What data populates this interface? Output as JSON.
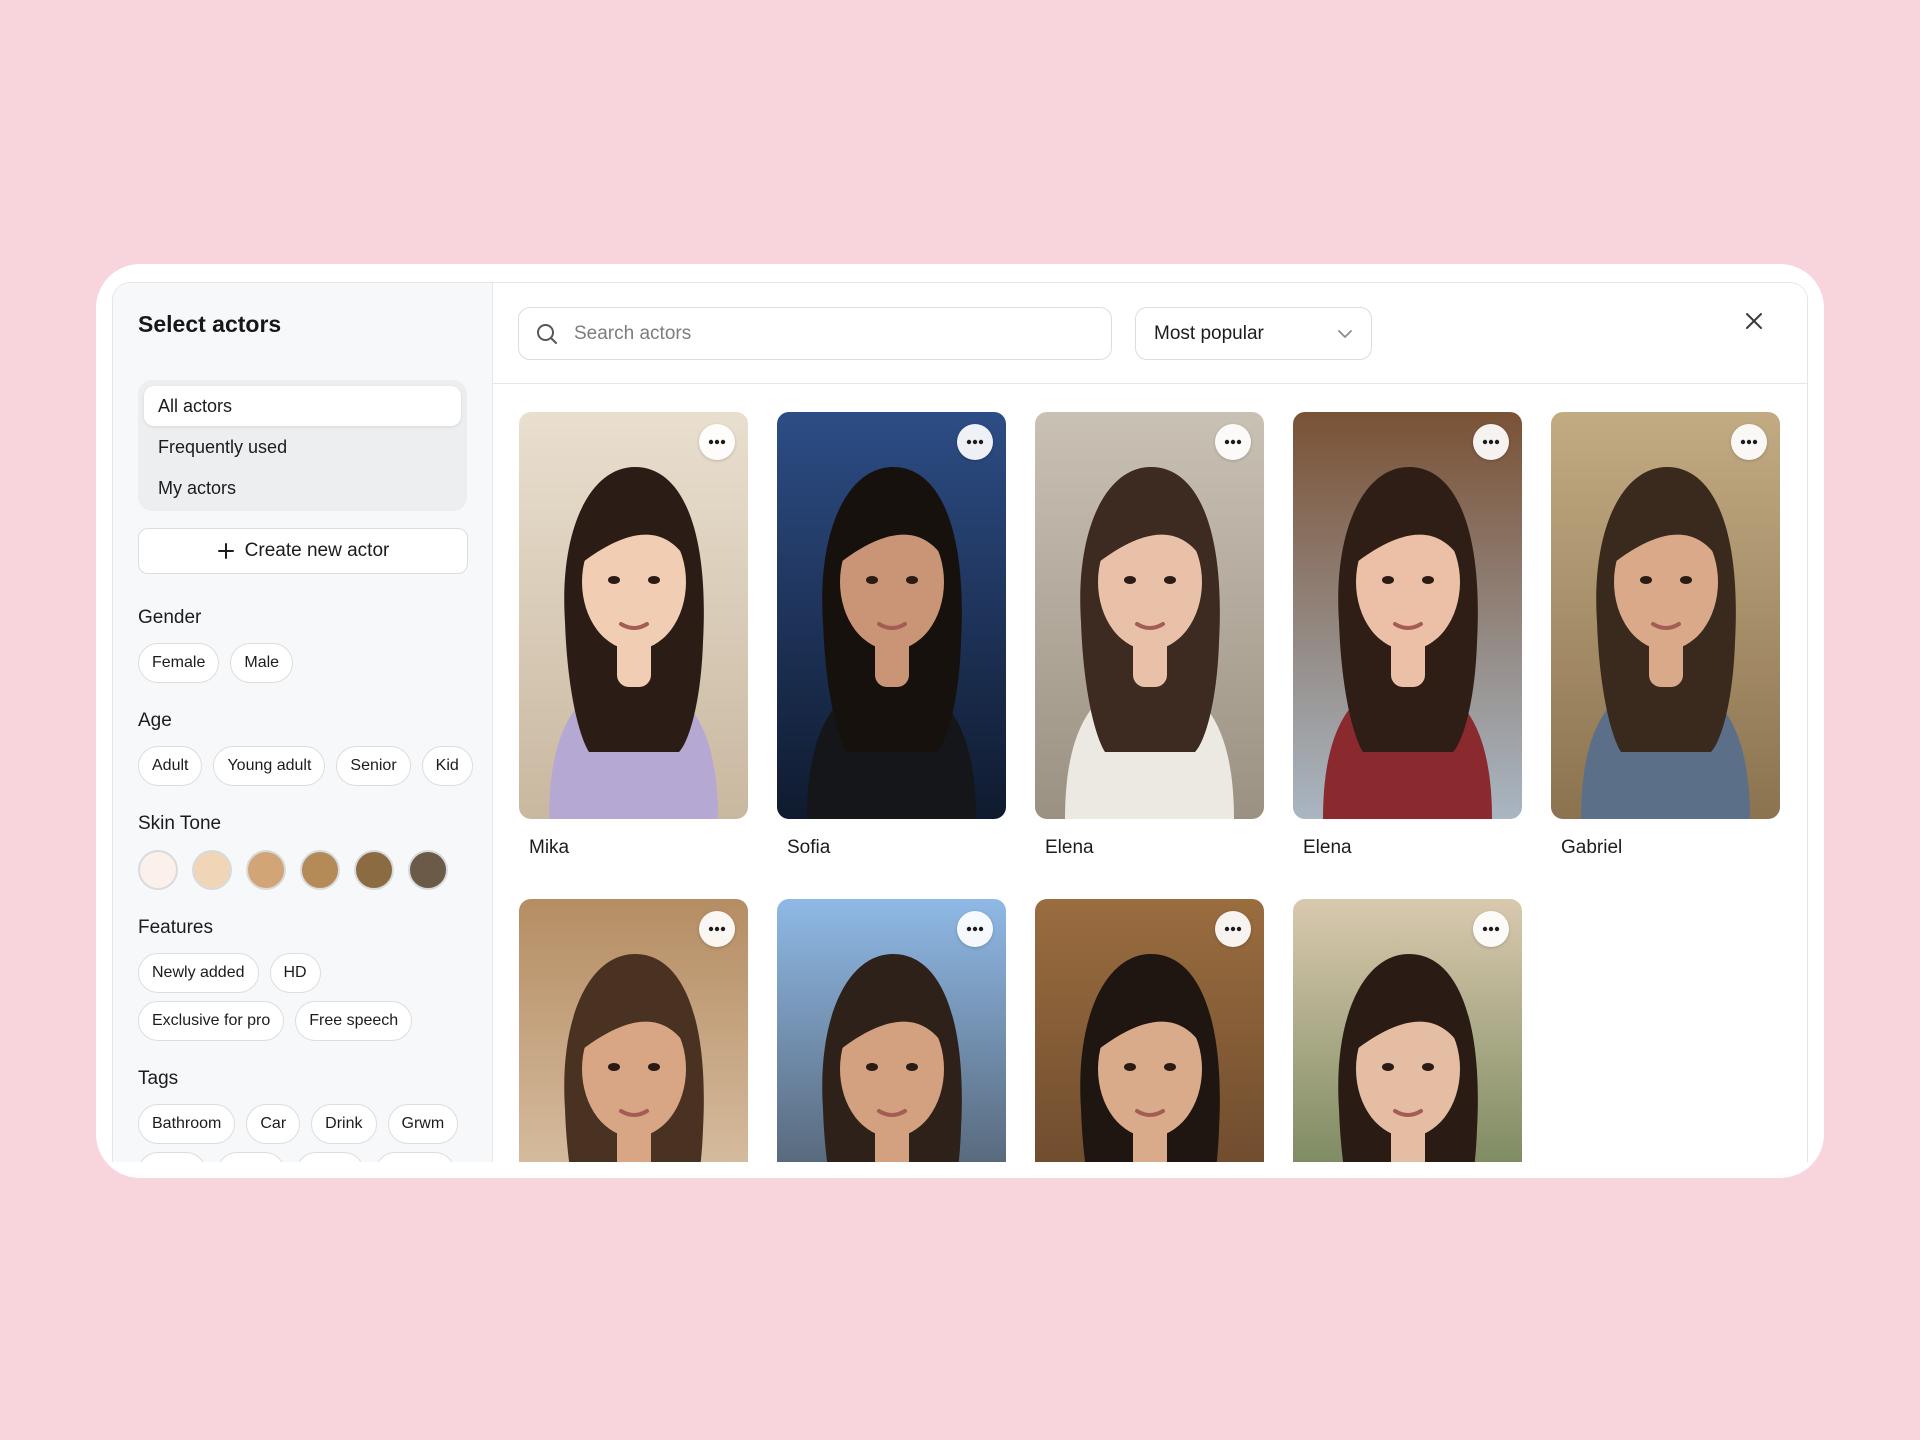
{
  "sidebar": {
    "title": "Select actors",
    "nav": [
      {
        "label": "All actors",
        "active": true
      },
      {
        "label": "Frequently used",
        "active": false
      },
      {
        "label": "My actors",
        "active": false
      }
    ],
    "create_label": "Create new actor",
    "gender": {
      "label": "Gender",
      "options": [
        "Female",
        "Male"
      ]
    },
    "age": {
      "label": "Age",
      "options": [
        "Adult",
        "Young adult",
        "Senior",
        "Kid"
      ]
    },
    "skin_tone": {
      "label": "Skin Tone",
      "colors": [
        "#fbf1ea",
        "#f1d5b7",
        "#d2a577",
        "#b48b56",
        "#8b6b42",
        "#6c5a48"
      ]
    },
    "features": {
      "label": "Features",
      "options": [
        "Newly added",
        "HD",
        "Exclusive for pro",
        "Free speech"
      ]
    },
    "tags": {
      "label": "Tags",
      "options": [
        "Bathroom",
        "Car",
        "Drink",
        "Grwm"
      ]
    }
  },
  "toolbar": {
    "search_placeholder": "Search actors",
    "sort_label": "Most popular"
  },
  "actors": [
    {
      "name": "Mika",
      "bg": "#e9dfcf",
      "bg2": "#c9b8a0",
      "hair": "#2b1d16",
      "skin": "#f0cdb3",
      "shirt": "#b5a9d4"
    },
    {
      "name": "Sofia",
      "bg": "#2d4d86",
      "bg2": "#0f1a2e",
      "hair": "#17110e",
      "skin": "#c99576",
      "shirt": "#15161a"
    },
    {
      "name": "Elena",
      "bg": "#c9c1b4",
      "bg2": "#9b9183",
      "hair": "#3d2a21",
      "skin": "#e8c1a8",
      "shirt": "#ece9e2"
    },
    {
      "name": "Elena",
      "bg": "#7a5236",
      "bg2": "#a9b6c2",
      "hair": "#2f1e16",
      "skin": "#ecc0a6",
      "shirt": "#8a2a2e"
    },
    {
      "name": "Gabriel",
      "bg": "#c2ab83",
      "bg2": "#8c7350",
      "hair": "#3a2a1e",
      "skin": "#d9a98a",
      "shirt": "#5c6f88"
    },
    {
      "name": "",
      "bg": "#b58d63",
      "bg2": "#e6d4bd",
      "hair": "#4a3222",
      "skin": "#d8a585",
      "shirt": "#8e8a83"
    },
    {
      "name": "",
      "bg": "#8fb9e6",
      "bg2": "#3b3f45",
      "hair": "#2e2119",
      "skin": "#d3a080",
      "shirt": "#8cb0d2"
    },
    {
      "name": "",
      "bg": "#9a6d3f",
      "bg2": "#5a3c26",
      "hair": "#1f1511",
      "skin": "#d9ab8b",
      "shirt": "#d8cfc3"
    },
    {
      "name": "",
      "bg": "#d9c9ae",
      "bg2": "#4f6b3a",
      "hair": "#2a1c15",
      "skin": "#e5bda2",
      "shirt": "#5d7ab8"
    }
  ]
}
